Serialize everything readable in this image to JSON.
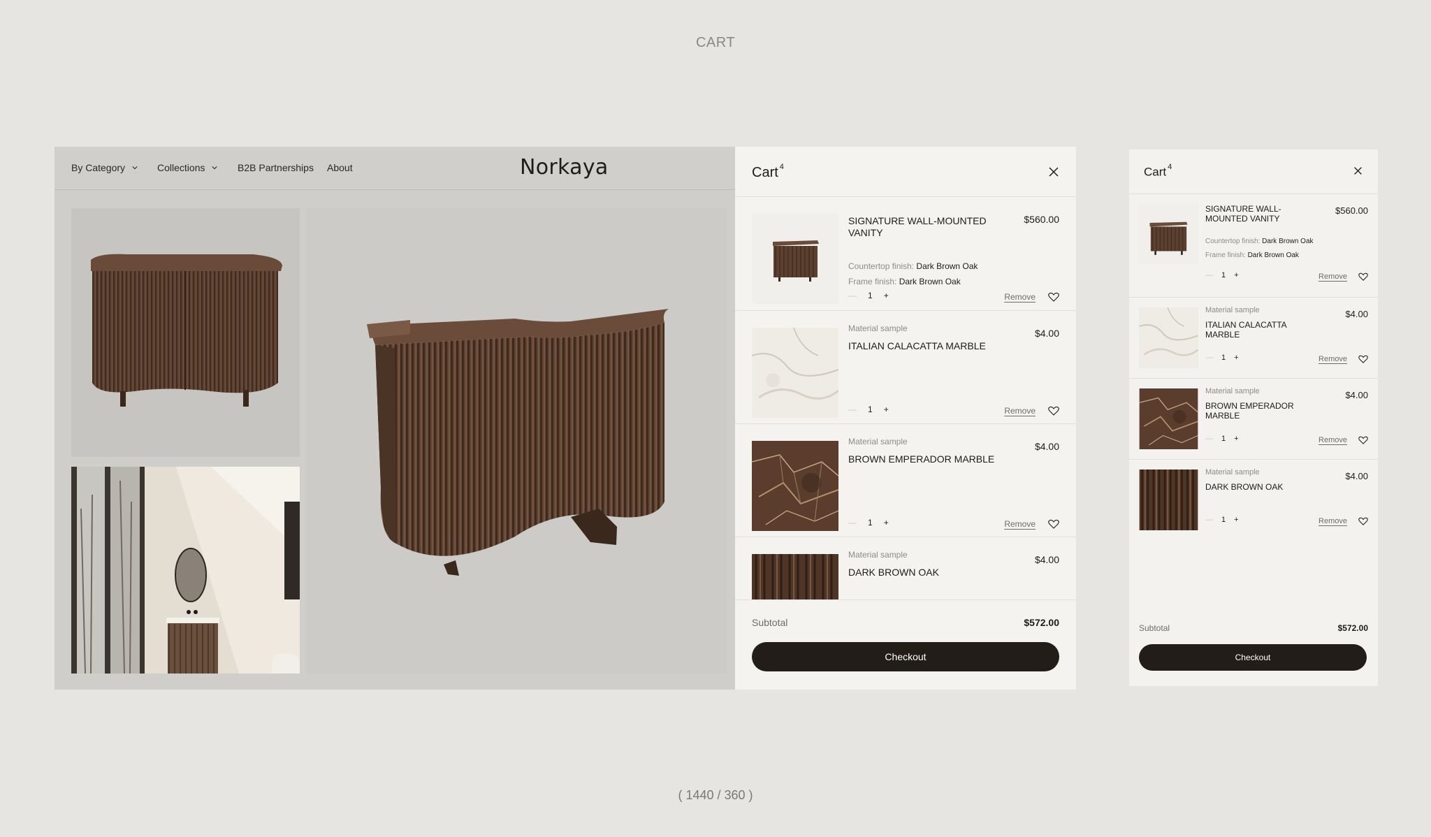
{
  "page": {
    "label": "CART",
    "footer": "( 1440 / 360 )"
  },
  "nav": {
    "items": [
      {
        "label": "By Category",
        "has_dropdown": true
      },
      {
        "label": "Collections",
        "has_dropdown": true
      },
      {
        "label": "B2B Partnerships",
        "has_dropdown": false
      },
      {
        "label": "About",
        "has_dropdown": false
      }
    ],
    "logo": "Norkaya"
  },
  "cart": {
    "title": "Cart",
    "count": "4",
    "items": [
      {
        "kicker": "",
        "name": "SIGNATURE WALL-MOUNTED VANITY",
        "price": "$560.00",
        "options": [
          {
            "label": "Countertop finish:",
            "value": "Dark Brown Oak"
          },
          {
            "label": "Frame finish:",
            "value": "Dark Brown Oak"
          }
        ],
        "quantity": "1",
        "thumb": "vanity-icon"
      },
      {
        "kicker": "Material sample",
        "name": "ITALIAN CALACATTA MARBLE",
        "price": "$4.00",
        "options": [],
        "quantity": "1",
        "thumb": "white-marble-swatch"
      },
      {
        "kicker": "Material sample",
        "name": "BROWN EMPERADOR MARBLE",
        "price": "$4.00",
        "options": [],
        "quantity": "1",
        "thumb": "brown-marble-swatch"
      },
      {
        "kicker": "Material sample",
        "name": "DARK BROWN OAK",
        "price": "$4.00",
        "options": [],
        "quantity": "1",
        "thumb": "oak-swatch"
      }
    ],
    "remove_label": "Remove",
    "subtotal_label": "Subtotal",
    "subtotal_value": "$572.00",
    "checkout_label": "Checkout"
  },
  "colors": {
    "background": "#e6e5e1",
    "panel": "#f4f3f0",
    "accent_dark": "#221d19",
    "wood": "#5a3f2e"
  }
}
